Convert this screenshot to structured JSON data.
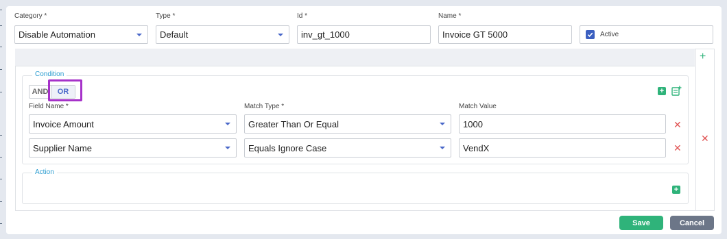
{
  "header": {
    "category_label": "Category *",
    "category_value": "Disable Automation",
    "type_label": "Type *",
    "type_value": "Default",
    "id_label": "Id *",
    "id_value": "inv_gt_1000",
    "name_label": "Name *",
    "name_value": "Invoice GT 5000",
    "active_label": "Active",
    "active_checked": true
  },
  "condition": {
    "legend": "Condition",
    "operator_and": "AND",
    "operator_or": "OR",
    "selected_operator": "OR",
    "field_name_label": "Field Name *",
    "match_type_label": "Match Type *",
    "match_value_label": "Match Value",
    "rows": [
      {
        "field_name": "Invoice Amount",
        "match_type": "Greater Than Or Equal",
        "match_value": "1000"
      },
      {
        "field_name": "Supplier Name",
        "match_type": "Equals Ignore Case",
        "match_value": "VendX"
      }
    ]
  },
  "action": {
    "legend": "Action"
  },
  "footer": {
    "save_label": "Save",
    "cancel_label": "Cancel"
  },
  "colors": {
    "accent": "#4a68c9",
    "success": "#2fb37a",
    "danger": "#e05252",
    "highlight": "#a632c9",
    "legend": "#2a9cd0"
  },
  "icons": {
    "add_rule": "plus-icon",
    "add_condition": "plus-square-icon",
    "add_group": "add-note-icon",
    "remove": "close-icon",
    "dropdown": "caret-down-icon",
    "checkbox": "check-icon"
  }
}
